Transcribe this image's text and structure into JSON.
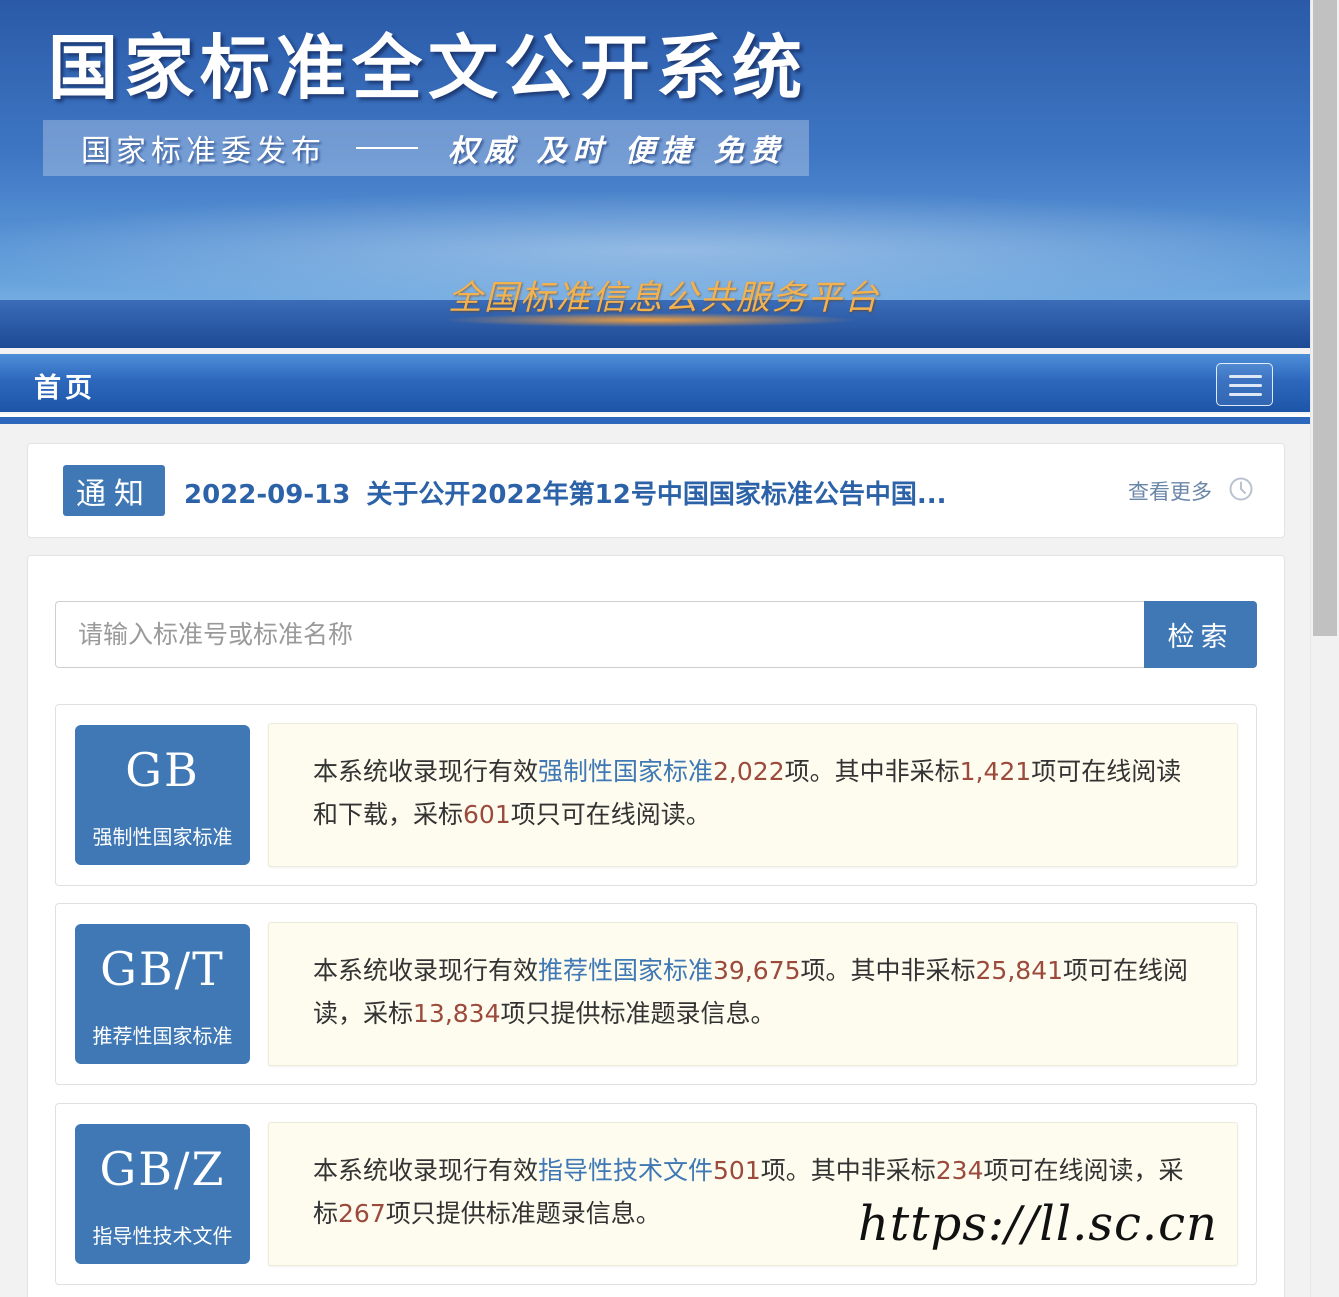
{
  "banner": {
    "title": "国家标准全文公开系统",
    "publisher": "国家标准委发布",
    "motto": "权威  及时  便捷  免费",
    "platform": "全国标准信息公共服务平台"
  },
  "nav": {
    "home": "首页",
    "menu_icon": "hamburger-menu-icon"
  },
  "notice": {
    "badge": "通知",
    "date": "2022-09-13",
    "title": "关于公开2022年第12号中国国家标准公告中国...",
    "more": "查看更多"
  },
  "search": {
    "placeholder": "请输入标准号或标准名称",
    "button": "检索"
  },
  "categories": [
    {
      "code": "GB",
      "name": "强制性国家标准",
      "t1": "本系统收录现行有效",
      "type": "强制性国家标准",
      "total": "2,022",
      "t2": "项。其中非采标",
      "nonadopted": "1,421",
      "t3": "项可在线阅读和下载，采标",
      "adopted": "601",
      "t4": "项只可在线阅读。"
    },
    {
      "code": "GB/T",
      "name": "推荐性国家标准",
      "t1": "本系统收录现行有效",
      "type": "推荐性国家标准",
      "total": "39,675",
      "t2": "项。其中非采标",
      "nonadopted": "25,841",
      "t3": "项可在线阅读，采标",
      "adopted": "13,834",
      "t4": "项只提供标准题录信息。"
    },
    {
      "code": "GB/Z",
      "name": "指导性技术文件",
      "t1": "本系统收录现行有效",
      "type": "指导性技术文件",
      "total": "501",
      "t2": "项。其中非采标",
      "nonadopted": "234",
      "t3": "项可在线阅读，采标",
      "adopted": "267",
      "t4": "项只提供标准题录信息。"
    }
  ],
  "watermark": "https://ll.sc.cn",
  "colors": {
    "accent": "#3f78b4",
    "number": "#9b4a3c",
    "nav": "#2d68bd"
  }
}
